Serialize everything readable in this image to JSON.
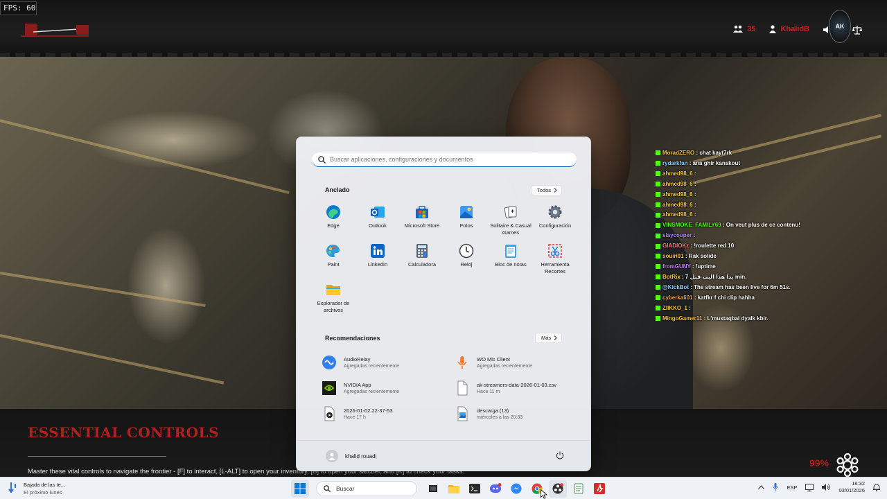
{
  "overlay": {
    "fps": "FPS: 60",
    "viewer_count": "35",
    "streamer_name": "KhalidB",
    "badge_text": "AK",
    "essential_title": "ESSENTIAL CONTROLS",
    "essential_text": "Master these vital controls to navigate the frontier - [F] to interact, [L-ALT] to open your inventory, [B] to open your satchel, and [K] to check your tasks.",
    "percent": "99%"
  },
  "chat": [
    {
      "user": "MoradZERO",
      "color": "#f6c744",
      "msg": ": chat kayt7rk"
    },
    {
      "user": "rydarkfan",
      "color": "#8fd3ff",
      "msg": ": ana ghir kanskout"
    },
    {
      "user": "ahmed98_6",
      "color": "#f6c744",
      "msg": ":"
    },
    {
      "user": "ahmed98_6",
      "color": "#f6c744",
      "msg": ":"
    },
    {
      "user": "ahmed98_6",
      "color": "#f6c744",
      "msg": ":"
    },
    {
      "user": "ahmed98_6",
      "color": "#f6c744",
      "msg": ":"
    },
    {
      "user": "ahmed98_6",
      "color": "#f6c744",
      "msg": ":"
    },
    {
      "user": "VINSMOKE_FAMILY69",
      "color": "#53fc18",
      "msg": ": On veut plus de ce contenu!"
    },
    {
      "user": "slaycooper",
      "color": "#b68cff",
      "msg": ":"
    },
    {
      "user": "GIADIOKz",
      "color": "#ff7b7b",
      "msg": ": !roulette red 10"
    },
    {
      "user": "souiri91",
      "color": "#f6c744",
      "msg": ": Rak solide"
    },
    {
      "user": "fromGUNY",
      "color": "#c77dff",
      "msg": ": !uptime"
    },
    {
      "user": "BotRix",
      "color": "#f6c744",
      "msg": ": بدا هذا البث قبل 7 min."
    },
    {
      "user": "@KickBot",
      "color": "#8fd3ff",
      "msg": ": The stream has been live for 6m 51s."
    },
    {
      "user": "cyberkali01",
      "color": "#f6a244",
      "msg": ": katfkr f chi clip hahha"
    },
    {
      "user": "ZIIKKO_1",
      "color": "#f6c744",
      "msg": ":"
    },
    {
      "user": "MingoGamer11",
      "color": "#f6c744",
      "msg": ": L'mustaqbal dyalk kbir."
    }
  ],
  "start_menu": {
    "search_placeholder": "Buscar aplicaciones, configuraciones y documentos",
    "pinned_title": "Anclado",
    "all_button": "Todos",
    "pinned": [
      {
        "label": "Edge",
        "icon": "edge-icon"
      },
      {
        "label": "Outlook",
        "icon": "outlook-icon"
      },
      {
        "label": "Microsoft Store",
        "icon": "store-icon"
      },
      {
        "label": "Fotos",
        "icon": "photos-icon"
      },
      {
        "label": "Solitaire & Casual Games",
        "icon": "solitaire-icon"
      },
      {
        "label": "Configuración",
        "icon": "settings-icon"
      },
      {
        "label": "Paint",
        "icon": "paint-icon"
      },
      {
        "label": "LinkedIn",
        "icon": "linkedin-icon"
      },
      {
        "label": "Calculadora",
        "icon": "calculator-icon"
      },
      {
        "label": "Reloj",
        "icon": "clock-icon"
      },
      {
        "label": "Bloc de notas",
        "icon": "notepad-icon"
      },
      {
        "label": "Herramienta Recortes",
        "icon": "snipping-tool-icon"
      },
      {
        "label": "Explorador de archivos",
        "icon": "file-explorer-icon"
      }
    ],
    "rec_title": "Recomendaciones",
    "more_button": "Más",
    "recommendations": [
      {
        "name": "AudioRelay",
        "sub": "Agregadas recientemente",
        "icon": "audiorelay-icon"
      },
      {
        "name": "WO Mic Client",
        "sub": "Agregadas recientemente",
        "icon": "microphone-icon"
      },
      {
        "name": "NVIDIA App",
        "sub": "Agregadas recientemente",
        "icon": "nvidia-icon"
      },
      {
        "name": "ak-streamers-data-2026-01-03.csv",
        "sub": "Hace 11 m",
        "icon": "file-icon"
      },
      {
        "name": "2026-01-02 22-37-53",
        "sub": "Hace 17 h",
        "icon": "video-file-icon"
      },
      {
        "name": "descarga (13)",
        "sub": "miércoles a las 20:33",
        "icon": "image-file-icon"
      }
    ],
    "user_name": "khalid rouadi"
  },
  "taskbar": {
    "weather_line1": "Bajada de las te...",
    "weather_line2": "El próximo lunes",
    "search_label": "Buscar",
    "language": "ESP",
    "time": "16:32",
    "date": "03/01/2026"
  },
  "colors": {
    "accent": "#0067c0",
    "brand_red": "#b02020",
    "kick_green": "#53fc18"
  }
}
